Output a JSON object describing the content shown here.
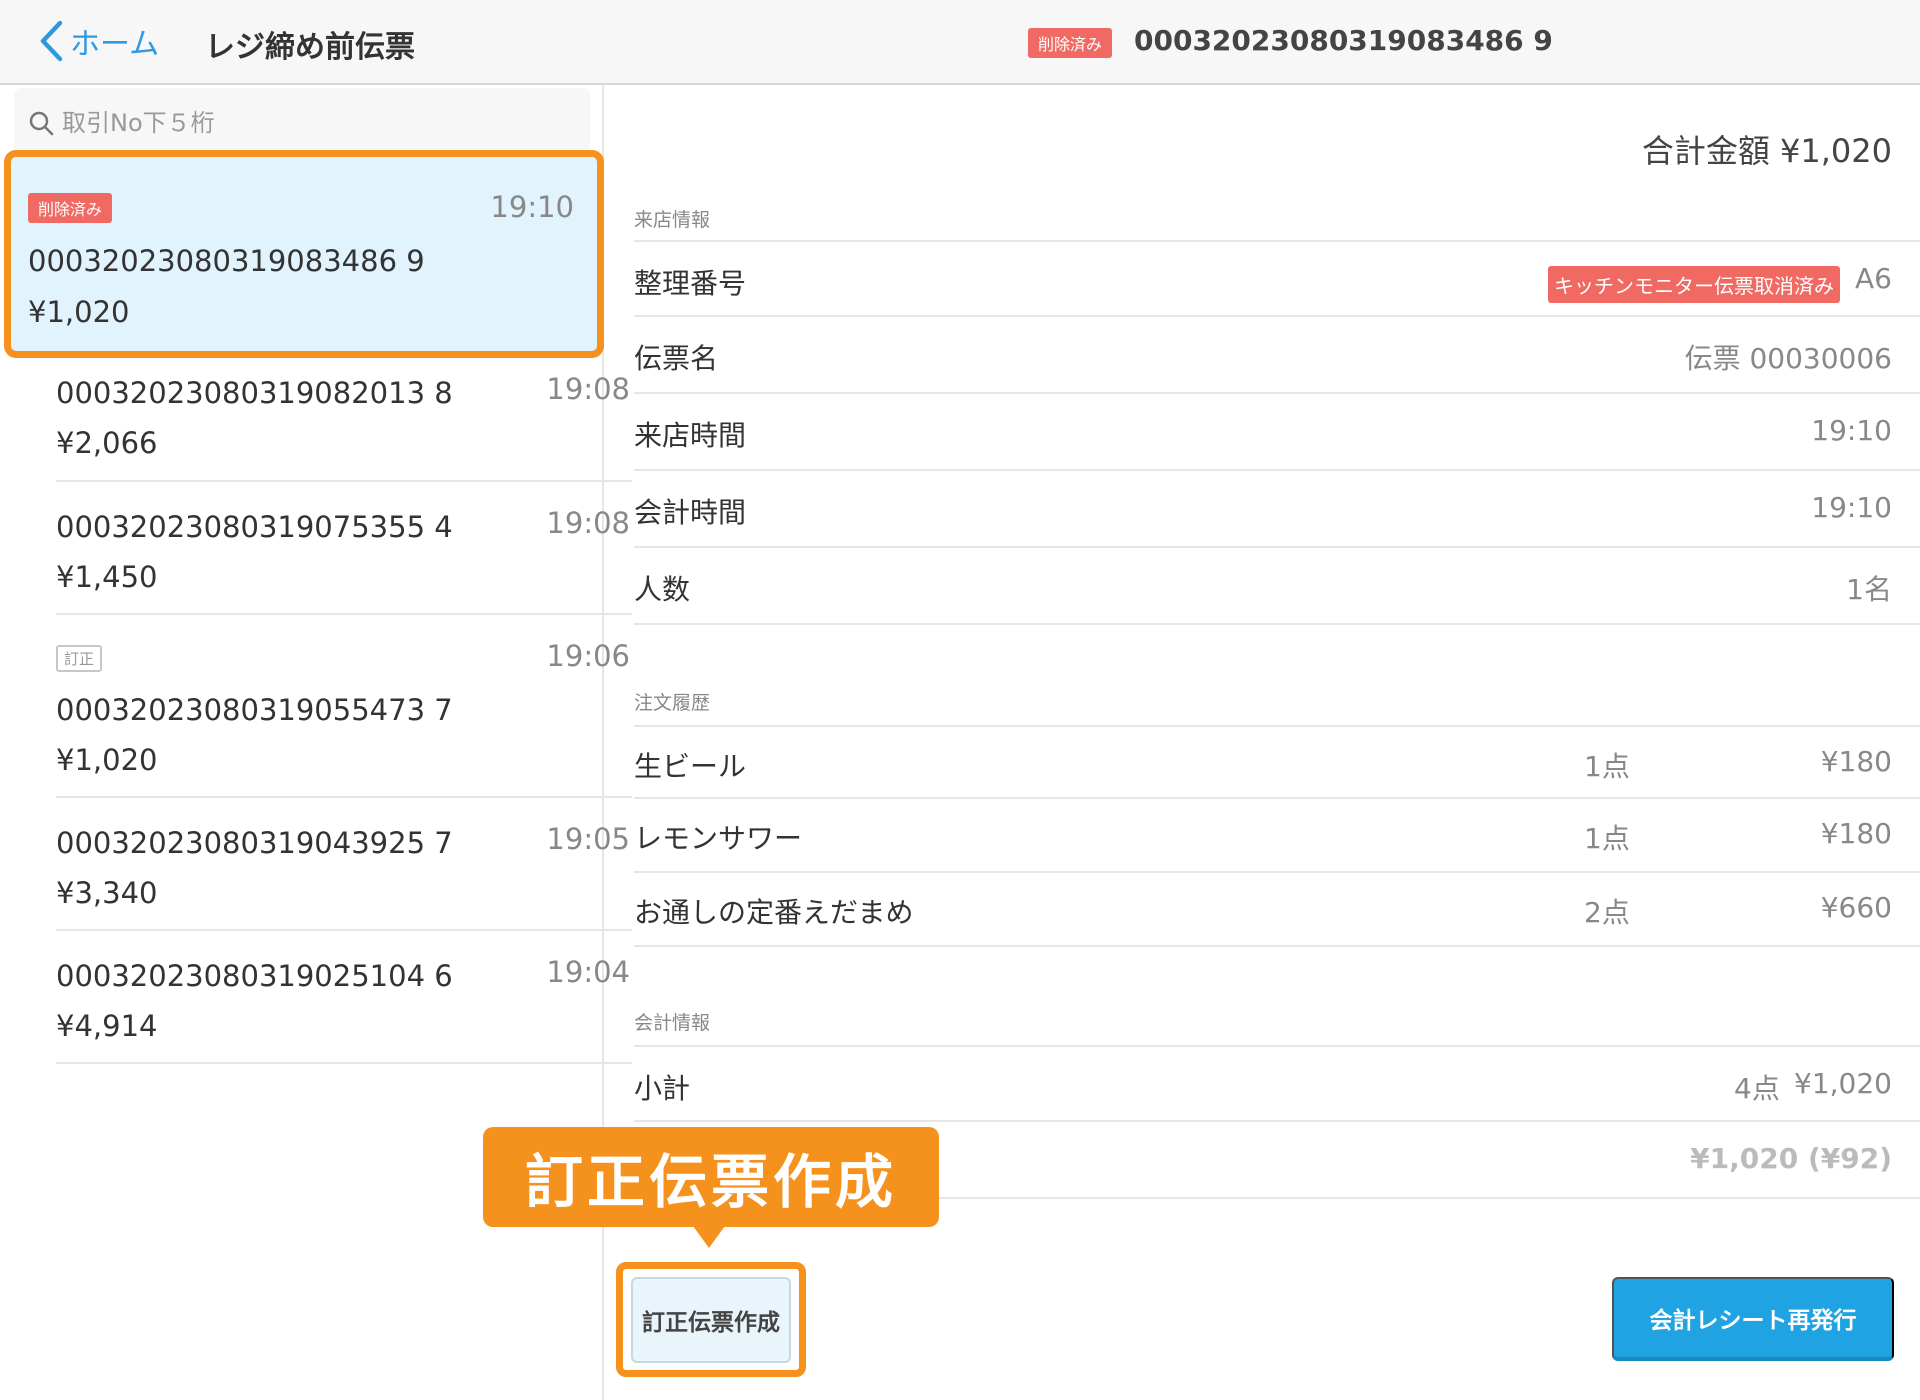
{
  "header": {
    "back_label": "ホーム",
    "title": "レジ締め前伝票"
  },
  "search": {
    "placeholder": "取引No下５桁"
  },
  "transactions": [
    {
      "badge": "削除済み",
      "number": "00032023080319083486 9",
      "amount": "¥1,020",
      "time": "19:10"
    },
    {
      "badge": "",
      "number": "00032023080319082013 8",
      "amount": "¥2,066",
      "time": "19:08"
    },
    {
      "badge": "",
      "number": "00032023080319075355 4",
      "amount": "¥1,450",
      "time": "19:08"
    },
    {
      "badge": "訂正",
      "number": "00032023080319055473 7",
      "amount": "¥1,020",
      "time": "19:06"
    },
    {
      "badge": "",
      "number": "00032023080319043925 7",
      "amount": "¥3,340",
      "time": "19:05"
    },
    {
      "badge": "",
      "number": "00032023080319025104 6",
      "amount": "¥4,914",
      "time": "19:04"
    }
  ],
  "detail": {
    "badge": "削除済み",
    "number": "00032023080319083486 9",
    "total": "合計金額 ¥1,020",
    "visit_section": "来店情報",
    "visit_rows": [
      {
        "label": "整理番号",
        "value": "A6",
        "badge": "キッチンモニター伝票取消済み"
      },
      {
        "label": "伝票名",
        "value": "伝票 00030006"
      },
      {
        "label": "来店時間",
        "value": "19:10"
      },
      {
        "label": "会計時間",
        "value": "19:10"
      },
      {
        "label": "人数",
        "value": "1名"
      }
    ],
    "order_section": "注文履歴",
    "order_rows": [
      {
        "label": "生ビール",
        "qty": "1点",
        "price": "¥180"
      },
      {
        "label": "レモンサワー",
        "qty": "1点",
        "price": "¥180"
      },
      {
        "label": "お通しの定番えだまめ",
        "qty": "2点",
        "price": "¥660"
      }
    ],
    "payment_section": "会計情報",
    "payment_rows": [
      {
        "label": "小計",
        "qty": "4点",
        "price": "¥1,020"
      },
      {
        "label": "",
        "qty": "",
        "price": "¥1,020 (¥92)"
      }
    ]
  },
  "footer": {
    "correct_label": "訂正伝票作成",
    "reissue_label": "会計レシート再発行"
  },
  "callout": {
    "label": "訂正伝票作成"
  },
  "colors": {
    "accent_blue": "#2d9ae0",
    "highlight_orange": "#f5921e",
    "deleted_red": "#f06a63",
    "selected_bg": "#e1f3fc"
  }
}
